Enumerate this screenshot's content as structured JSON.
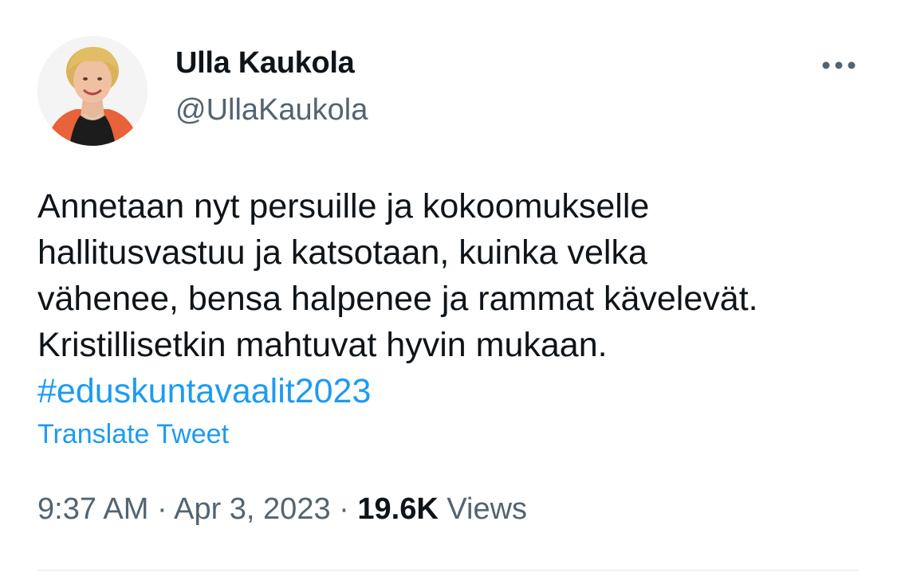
{
  "author": {
    "display_name": "Ulla Kaukola",
    "handle": "@UllaKaukola",
    "avatar_icon": "profile-photo"
  },
  "menu": {
    "more_icon": "more-horizontal-icon"
  },
  "tweet": {
    "lines": [
      "Annetaan nyt persuille ja kokoomukselle",
      "hallitusvastuu ja katsotaan, kuinka velka",
      "vähenee, bensa halpenee ja rammat kävelevät.",
      "Kristillisetkin mahtuvat hyvin mukaan."
    ],
    "hashtag": "#eduskuntavaalit2023",
    "translate_label": "Translate Tweet"
  },
  "meta": {
    "time": "9:37 AM",
    "separator": "·",
    "date": "Apr 3, 2023",
    "views_count": "19.6K",
    "views_label": "Views"
  },
  "colors": {
    "link": "#1d9bf0",
    "secondary_text": "#536471",
    "primary_text": "#0f1419"
  }
}
